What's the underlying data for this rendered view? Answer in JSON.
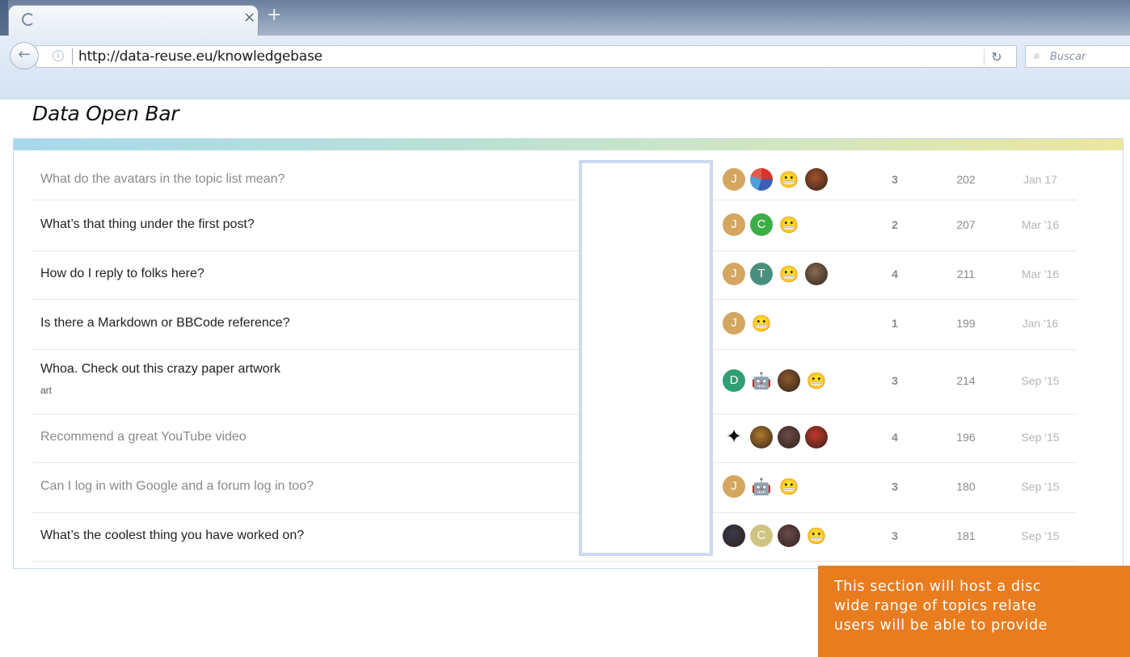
{
  "browser": {
    "new_tab_label": "+",
    "close_tab_label": "×",
    "url": "http://data-reuse.eu/knowledgebase",
    "search_placeholder": "Buscar",
    "reload_icon": "reload-icon",
    "back_icon": "back-arrow-icon"
  },
  "page": {
    "title": "Data Open Bar"
  },
  "colors": {
    "accent_orange": "#e87c1e",
    "placeholder_border": "#ccd9ee",
    "panel_border": "#c9d9ea"
  },
  "topics": [
    {
      "title": "What do the avatars in the topic list mean?",
      "tag": "",
      "read": true,
      "posters": [
        {
          "type": "letter",
          "letter": "J",
          "color": "#d4a660"
        },
        {
          "type": "icon",
          "icon": "colorful-logo-icon",
          "color": "#3b5eb8"
        },
        {
          "type": "icon",
          "icon": "spiky-face-icon",
          "color": "#ffffff"
        },
        {
          "type": "photo",
          "icon": "photo-avatar",
          "color": "#a0522d"
        }
      ],
      "replies": "3",
      "views": "202",
      "activity": "Jan 17"
    },
    {
      "title": "What’s that thing under the first post?",
      "tag": "",
      "read": false,
      "posters": [
        {
          "type": "letter",
          "letter": "J",
          "color": "#d4a660"
        },
        {
          "type": "letter",
          "letter": "C",
          "color": "#3cae45"
        },
        {
          "type": "icon",
          "icon": "spiky-face-icon",
          "color": "#ffffff"
        }
      ],
      "replies": "2",
      "views": "207",
      "activity": "Mar '16"
    },
    {
      "title": "How do I reply to folks here?",
      "tag": "",
      "read": false,
      "posters": [
        {
          "type": "letter",
          "letter": "J",
          "color": "#d4a660"
        },
        {
          "type": "letter",
          "letter": "T",
          "color": "#4a8f7e"
        },
        {
          "type": "icon",
          "icon": "spiky-face-icon",
          "color": "#ffffff"
        },
        {
          "type": "photo",
          "icon": "photo-avatar",
          "color": "#8a6a52"
        }
      ],
      "replies": "4",
      "views": "211",
      "activity": "Mar '16"
    },
    {
      "title": "Is there a Markdown or BBCode reference?",
      "tag": "",
      "read": false,
      "posters": [
        {
          "type": "letter",
          "letter": "J",
          "color": "#d4a660"
        },
        {
          "type": "icon",
          "icon": "spiky-face-icon",
          "color": "#ffffff"
        }
      ],
      "replies": "1",
      "views": "199",
      "activity": "Jan '16"
    },
    {
      "title": "Whoa. Check out this crazy paper artwork",
      "tag": "art",
      "read": false,
      "posters": [
        {
          "type": "letter",
          "letter": "D",
          "color": "#2e9e73"
        },
        {
          "type": "icon",
          "icon": "robot-icon",
          "color": "#ffffff"
        },
        {
          "type": "photo",
          "icon": "sloth-avatar",
          "color": "#8a5a2e"
        },
        {
          "type": "icon",
          "icon": "spiky-face-icon",
          "color": "#ffffff"
        }
      ],
      "replies": "3",
      "views": "214",
      "activity": "Sep '15"
    },
    {
      "title": "Recommend a great YouTube video",
      "tag": "",
      "read": true,
      "posters": [
        {
          "type": "icon",
          "icon": "black-bird-icon",
          "color": "#ffffff"
        },
        {
          "type": "photo",
          "icon": "photo-avatar",
          "color": "#b07a2e"
        },
        {
          "type": "photo",
          "icon": "photo-avatar",
          "color": "#6a4a4a"
        },
        {
          "type": "photo",
          "icon": "photo-avatar",
          "color": "#c0392b"
        }
      ],
      "replies": "4",
      "views": "196",
      "activity": "Sep '15"
    },
    {
      "title": "Can I log in with Google and a forum log in too?",
      "tag": "",
      "read": true,
      "posters": [
        {
          "type": "letter",
          "letter": "J",
          "color": "#d4a660"
        },
        {
          "type": "icon",
          "icon": "robot-icon",
          "color": "#ffffff"
        },
        {
          "type": "icon",
          "icon": "spiky-face-icon",
          "color": "#ffffff"
        }
      ],
      "replies": "3",
      "views": "180",
      "activity": "Sep '15"
    },
    {
      "title": "What’s the coolest thing you have worked on?",
      "tag": "",
      "read": false,
      "posters": [
        {
          "type": "photo",
          "icon": "photo-avatar",
          "color": "#3a3a4a"
        },
        {
          "type": "letter",
          "letter": "C",
          "color": "#d0c484"
        },
        {
          "type": "photo",
          "icon": "photo-avatar",
          "color": "#6a4a4a"
        },
        {
          "type": "icon",
          "icon": "spiky-face-icon",
          "color": "#ffffff"
        }
      ],
      "replies": "3",
      "views": "181",
      "activity": "Sep '15"
    }
  ],
  "callout": {
    "line1": "This section will host a disc",
    "line2": "wide range of topics relate",
    "line3": "users will be able to provide"
  }
}
